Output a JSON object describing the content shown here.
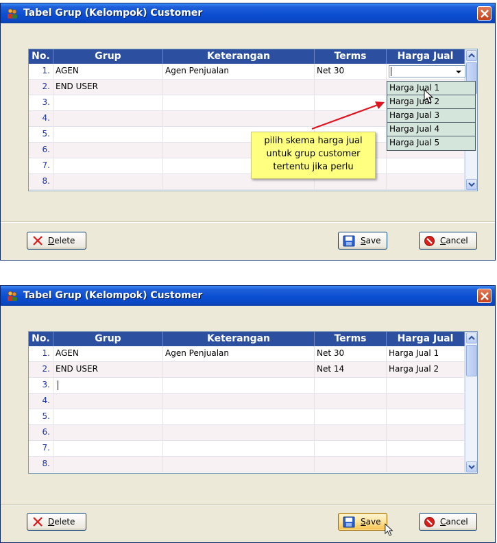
{
  "title": "Tabel Grup (Kelompok) Customer",
  "columns": [
    "No.",
    "Grup",
    "Keterangan",
    "Terms",
    "Harga Jual"
  ],
  "window1": {
    "rows": [
      {
        "no": "1.",
        "grup": "AGEN",
        "keterangan": "Agen Penjualan",
        "terms": "Net 30",
        "harga": ""
      },
      {
        "no": "2.",
        "grup": "END USER",
        "keterangan": "",
        "terms": "",
        "harga": ""
      },
      {
        "no": "3.",
        "grup": "",
        "keterangan": "",
        "terms": "",
        "harga": ""
      },
      {
        "no": "4.",
        "grup": "",
        "keterangan": "",
        "terms": "",
        "harga": ""
      },
      {
        "no": "5.",
        "grup": "",
        "keterangan": "",
        "terms": "",
        "harga": ""
      },
      {
        "no": "6.",
        "grup": "",
        "keterangan": "",
        "terms": "",
        "harga": ""
      },
      {
        "no": "7.",
        "grup": "",
        "keterangan": "",
        "terms": "",
        "harga": ""
      },
      {
        "no": "8.",
        "grup": "",
        "keterangan": "",
        "terms": "",
        "harga": ""
      }
    ],
    "dropdown_options": [
      "Harga Jual 1",
      "Harga Jual 2",
      "Harga Jual 3",
      "Harga Jual 4",
      "Harga Jual 5"
    ],
    "note_lines": [
      "pilih skema harga jual",
      "untuk grup customer",
      "tertentu jika perlu"
    ]
  },
  "window2": {
    "rows": [
      {
        "no": "1.",
        "grup": "AGEN",
        "keterangan": "Agen Penjualan",
        "terms": "Net 30",
        "harga": "Harga Jual 1"
      },
      {
        "no": "2.",
        "grup": "END USER",
        "keterangan": "",
        "terms": "Net 14",
        "harga": "Harga Jual 2"
      },
      {
        "no": "3.",
        "grup": "",
        "keterangan": "",
        "terms": "",
        "harga": ""
      },
      {
        "no": "4.",
        "grup": "",
        "keterangan": "",
        "terms": "",
        "harga": ""
      },
      {
        "no": "5.",
        "grup": "",
        "keterangan": "",
        "terms": "",
        "harga": ""
      },
      {
        "no": "6.",
        "grup": "",
        "keterangan": "",
        "terms": "",
        "harga": ""
      },
      {
        "no": "7.",
        "grup": "",
        "keterangan": "",
        "terms": "",
        "harga": ""
      },
      {
        "no": "8.",
        "grup": "",
        "keterangan": "",
        "terms": "",
        "harga": ""
      }
    ]
  },
  "buttons": {
    "delete": {
      "first": "D",
      "rest": "elete"
    },
    "save": {
      "first": "S",
      "rest": "ave"
    },
    "cancel": {
      "first": "C",
      "rest": "ancel"
    }
  },
  "icons": {
    "app": "customer-group-icon",
    "close": "close-icon",
    "delete": "delete-x-icon",
    "save": "floppy-disk-icon",
    "cancel": "cancel-icon"
  },
  "colors": {
    "titlebar": "#0b4fd2",
    "grid_header": "#2c4fa0",
    "note": "#ffff80",
    "dropdown": "#d4e5dc",
    "arrow": "#e0141e"
  }
}
